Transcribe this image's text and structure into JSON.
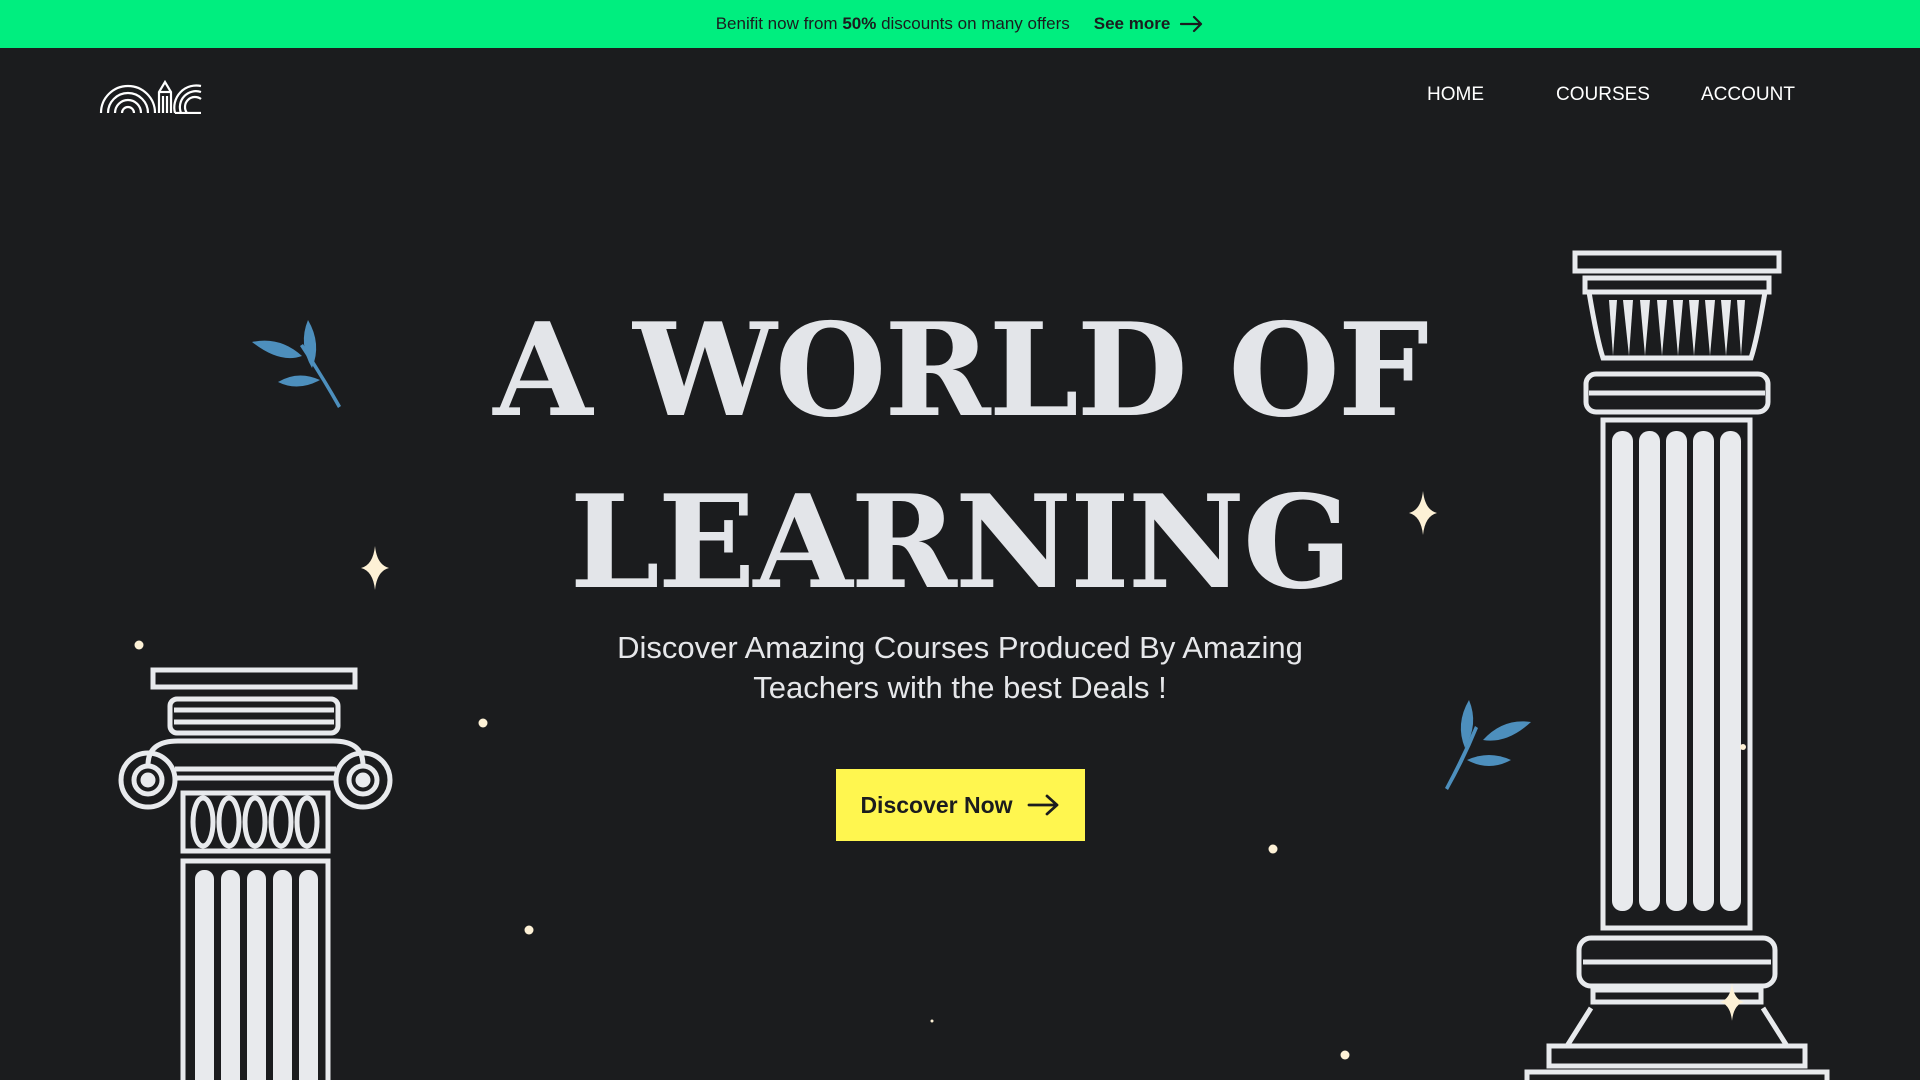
{
  "colors": {
    "promo_bg": "#00ee7f",
    "page_bg": "#1b1c1e",
    "cta_bg": "#fff64f",
    "leaf": "#4d8fbd",
    "sparkle": "#fdf1d6",
    "column": "#e8eaed"
  },
  "promo": {
    "text_prefix": "Benifit now from ",
    "text_bold": "50%",
    "text_suffix": " discounts on many offers",
    "link_label": "See more",
    "link_icon": "arrow-right-icon"
  },
  "logo": {
    "icon": "arches-pencil-logo-icon"
  },
  "nav": {
    "items": [
      {
        "label": "HOME"
      },
      {
        "label": "COURSES"
      },
      {
        "label": "ACCOUNT"
      }
    ]
  },
  "hero": {
    "title_line1": "A WORLD OF",
    "title_line2": "LEARNING",
    "subtitle_line1": "Discover Amazing Courses Produced By Amazing",
    "subtitle_line2": "Teachers with the best Deals !",
    "cta_label": "Discover Now",
    "cta_icon": "arrow-right-icon"
  },
  "decorations": {
    "left_column": "ionic-column-illustration",
    "right_column": "corinthian-column-illustration",
    "leaf_icon": "olive-branch-icon",
    "sparkle_icon": "four-point-star-icon"
  }
}
